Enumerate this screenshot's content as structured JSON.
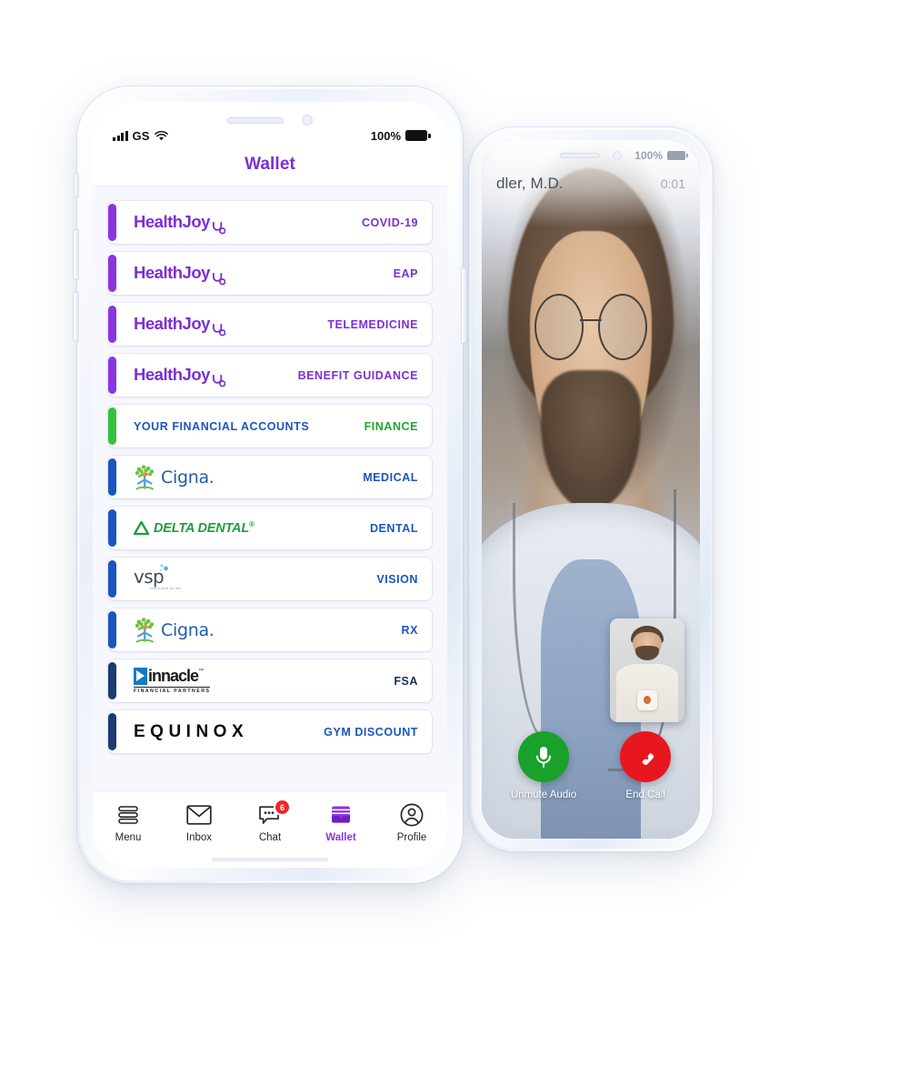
{
  "scene": {
    "background": "#ffffff",
    "description": "Two smartphone mockups: a HealthJoy Wallet screen and a telemedicine video call screen"
  },
  "wallet_phone": {
    "status_bar": {
      "carrier": "GS",
      "signal_icon": "cellular-signal-icon",
      "wifi_icon": "wifi-icon",
      "battery_percent": "100%",
      "battery_icon": "battery-full-icon"
    },
    "header": {
      "title": "Wallet",
      "title_color": "#7B2FD4"
    },
    "cards": [
      {
        "logo_type": "healthjoy",
        "logo_text": "HealthJoy",
        "category": "COVID-19",
        "bar_color": "#8B35E0",
        "category_color": "#7B2FD4"
      },
      {
        "logo_type": "healthjoy",
        "logo_text": "HealthJoy",
        "category": "EAP",
        "bar_color": "#8B35E0",
        "category_color": "#7B2FD4"
      },
      {
        "logo_type": "healthjoy",
        "logo_text": "HealthJoy",
        "category": "TELEMEDICINE",
        "bar_color": "#8B35E0",
        "category_color": "#7B2FD4"
      },
      {
        "logo_type": "healthjoy",
        "logo_text": "HealthJoy",
        "category": "BENEFIT GUIDANCE",
        "bar_color": "#8B35E0",
        "category_color": "#7B2FD4"
      },
      {
        "logo_type": "text",
        "logo_text": "YOUR FINANCIAL ACCOUNTS",
        "category": "FINANCE",
        "bar_color": "#34C13E",
        "category_color": "#1FA82C"
      },
      {
        "logo_type": "cigna",
        "logo_text": "Cigna",
        "category": "MEDICAL",
        "bar_color": "#1A56BE",
        "category_color": "#1A56BE"
      },
      {
        "logo_type": "delta",
        "logo_text": "DELTA DENTAL",
        "category": "DENTAL",
        "bar_color": "#1A56BE",
        "category_color": "#1A56BE"
      },
      {
        "logo_type": "vsp",
        "logo_text": "vsp",
        "logo_tagline": "vision care for life",
        "category": "VISION",
        "bar_color": "#1A56BE",
        "category_color": "#1A56BE"
      },
      {
        "logo_type": "cigna",
        "logo_text": "Cigna",
        "category": "RX",
        "bar_color": "#1A56BE",
        "category_color": "#1A56BE"
      },
      {
        "logo_type": "pinnacle",
        "logo_text": "innacle",
        "logo_sub": "FINANCIAL PARTNERS",
        "category": "FSA",
        "bar_color": "#1B3C72",
        "category_color": "#1A2E5C"
      },
      {
        "logo_type": "equinox",
        "logo_text": "EQUINOX",
        "category": "GYM DISCOUNT",
        "bar_color": "#1B3C72",
        "category_color": "#1A56BE"
      }
    ],
    "tabs": [
      {
        "label": "Menu",
        "icon": "menu-lines-icon",
        "active": false,
        "badge": ""
      },
      {
        "label": "Inbox",
        "icon": "envelope-icon",
        "active": false,
        "badge": ""
      },
      {
        "label": "Chat",
        "icon": "chat-bubble-icon",
        "active": false,
        "badge": "6"
      },
      {
        "label": "Wallet",
        "icon": "wallet-icon",
        "active": true,
        "badge": ""
      },
      {
        "label": "Profile",
        "icon": "person-circle-icon",
        "active": false,
        "badge": ""
      }
    ],
    "active_tab_color": "#8B35E0"
  },
  "video_phone": {
    "status_bar": {
      "battery_percent": "100%",
      "battery_icon": "battery-full-icon"
    },
    "call": {
      "doctor_name": "dler, M.D.",
      "timer": "0:01",
      "self_view": "self-video-preview"
    },
    "controls": [
      {
        "label": "Unmute Audio",
        "icon": "microphone-icon",
        "color": "#19A129"
      },
      {
        "label": "End Call",
        "icon": "end-call-icon",
        "color": "#E8171F"
      }
    ]
  }
}
